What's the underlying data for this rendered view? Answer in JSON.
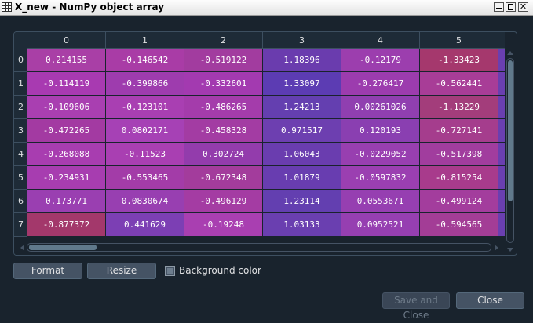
{
  "window": {
    "title": "X_new - NumPy object array",
    "app_icon": "table-grid-icon",
    "controls": {
      "minimize": "minimize-icon",
      "maximize": "maximize-icon",
      "close_glyph": "✕"
    }
  },
  "table": {
    "columns": [
      "0",
      "1",
      "2",
      "3",
      "4",
      "5"
    ],
    "rows": [
      {
        "index": "0",
        "values": [
          "0.214155",
          "-0.146542",
          "-0.519122",
          "1.18396",
          "-0.12179",
          "-1.33423"
        ]
      },
      {
        "index": "1",
        "values": [
          "-0.114119",
          "-0.399866",
          "-0.332601",
          "1.33097",
          "-0.276417",
          "-0.562441"
        ]
      },
      {
        "index": "2",
        "values": [
          "-0.109606",
          "-0.123101",
          "-0.486265",
          "1.24213",
          "0.00261026",
          "-1.13229"
        ]
      },
      {
        "index": "3",
        "values": [
          "-0.472265",
          "0.0802171",
          "-0.458328",
          "0.971517",
          "0.120193",
          "-0.727141"
        ]
      },
      {
        "index": "4",
        "values": [
          "-0.268088",
          "-0.11523",
          "0.302724",
          "1.06043",
          "-0.0229052",
          "-0.517398"
        ]
      },
      {
        "index": "5",
        "values": [
          "-0.234931",
          "-0.553465",
          "-0.672348",
          "1.01879",
          "-0.0597832",
          "-0.815254"
        ]
      },
      {
        "index": "6",
        "values": [
          "0.173771",
          "0.0830674",
          "-0.496129",
          "1.23114",
          "0.0553671",
          "-0.499124"
        ]
      },
      {
        "index": "7",
        "values": [
          "-0.877372",
          "0.441629",
          "-0.19248",
          "1.03133",
          "0.0952521",
          "-0.594565"
        ]
      }
    ],
    "cell_colors": [
      [
        "#a93fa6",
        "#a93ca6",
        "#a23c9f",
        "#6a3cae",
        "#9c3eae",
        "#a5386d"
      ],
      [
        "#a83ab1",
        "#9e3cae",
        "#a33ab0",
        "#5c3cb3",
        "#9c3cae",
        "#a83d97"
      ],
      [
        "#a93fb1",
        "#a93fb2",
        "#a43cab",
        "#643fb0",
        "#903fb0",
        "#a33d7b"
      ],
      [
        "#a33aa2",
        "#a641b5",
        "#a33ca3",
        "#6d3fb0",
        "#8a3fb1",
        "#a53d8d"
      ],
      [
        "#a83db0",
        "#a93fb2",
        "#933cac",
        "#6a3daf",
        "#983fb0",
        "#a13d9e"
      ],
      [
        "#a73db0",
        "#a33ca8",
        "#a33c9c",
        "#683db0",
        "#9b3fb1",
        "#a83b8c"
      ],
      [
        "#9a3fb1",
        "#983fb1",
        "#a43ca3",
        "#633fb0",
        "#963fb1",
        "#a33d9d"
      ],
      [
        "#a3386b",
        "#7c3fb4",
        "#a93fb1",
        "#6a3fb0",
        "#963fb1",
        "#a33d96"
      ]
    ],
    "colors": {
      "header_bg": "#1e2b37",
      "grid": "#3d4f60",
      "text": "#ffffff"
    }
  },
  "scrollbars": {
    "vertical": "vertical-scrollbar",
    "horizontal": "horizontal-scrollbar"
  },
  "buttons": {
    "format": "Format",
    "resize": "Resize",
    "save_and_close": "Save and Close",
    "close": "Close"
  },
  "background_color": {
    "label": "Background color",
    "checked": true
  }
}
